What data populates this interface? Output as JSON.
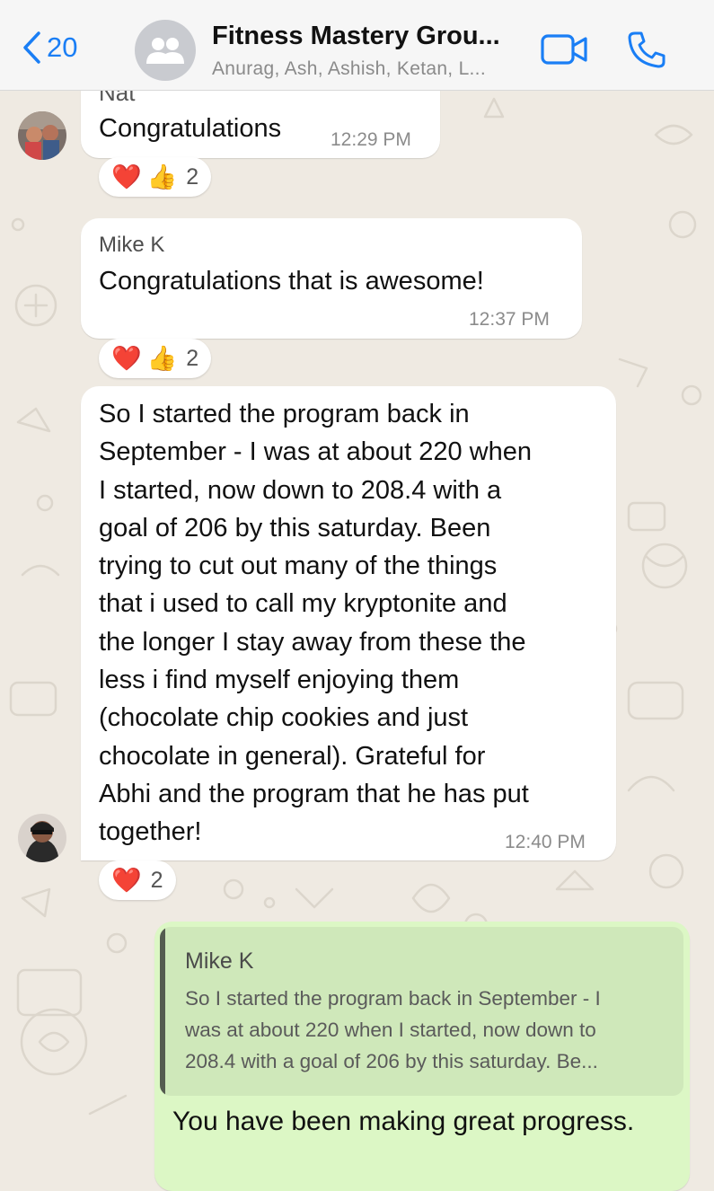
{
  "header": {
    "back_count": "20",
    "group_title": "Fitness Mastery Grou...",
    "group_members": "Anurag, Ash, Ashish, Ketan, L..."
  },
  "messages": [
    {
      "sender": "Nat",
      "text": "Congratulations",
      "time": "12:29 PM",
      "reactions": {
        "emojis": [
          "❤️",
          "👍"
        ],
        "count": "2"
      }
    },
    {
      "sender": "Mike K",
      "text": "Congratulations that is awesome!",
      "time": "12:37 PM",
      "reactions": {
        "emojis": [
          "❤️",
          "👍"
        ],
        "count": "2"
      }
    },
    {
      "lines": [
        "So I started the program back in",
        "September - I was at about 220 when",
        "I started, now down to 208.4 with a",
        "goal of 206 by this saturday.  Been",
        "trying to cut out many of the things",
        "that i used to call my kryptonite and",
        "the longer I stay away from these the",
        "less i find myself enjoying them",
        "(chocolate chip cookies and just",
        "chocolate in general).  Grateful for",
        "Abhi and the program that he has put",
        "together!"
      ],
      "time": "12:40 PM",
      "reactions": {
        "emojis": [
          "❤️"
        ],
        "count": "2"
      }
    },
    {
      "quote_author": "Mike K",
      "quote_lines": [
        "So I started the program back in September - I",
        "was at about 220 when I started, now down to",
        "208.4 with a goal of 206 by this saturday.  Be..."
      ],
      "text": "You have been making great progress."
    }
  ],
  "colors": {
    "accent": "#1a7ef5",
    "chat_background": "#efeae2",
    "incoming_bubble": "#ffffff",
    "outgoing_bubble": "#dcf7c5",
    "quote_background": "#cfe8ba"
  },
  "icons": {
    "back": "chevron-left-icon",
    "avatar": "group-icon",
    "video": "video-camera-icon",
    "call": "phone-icon"
  }
}
